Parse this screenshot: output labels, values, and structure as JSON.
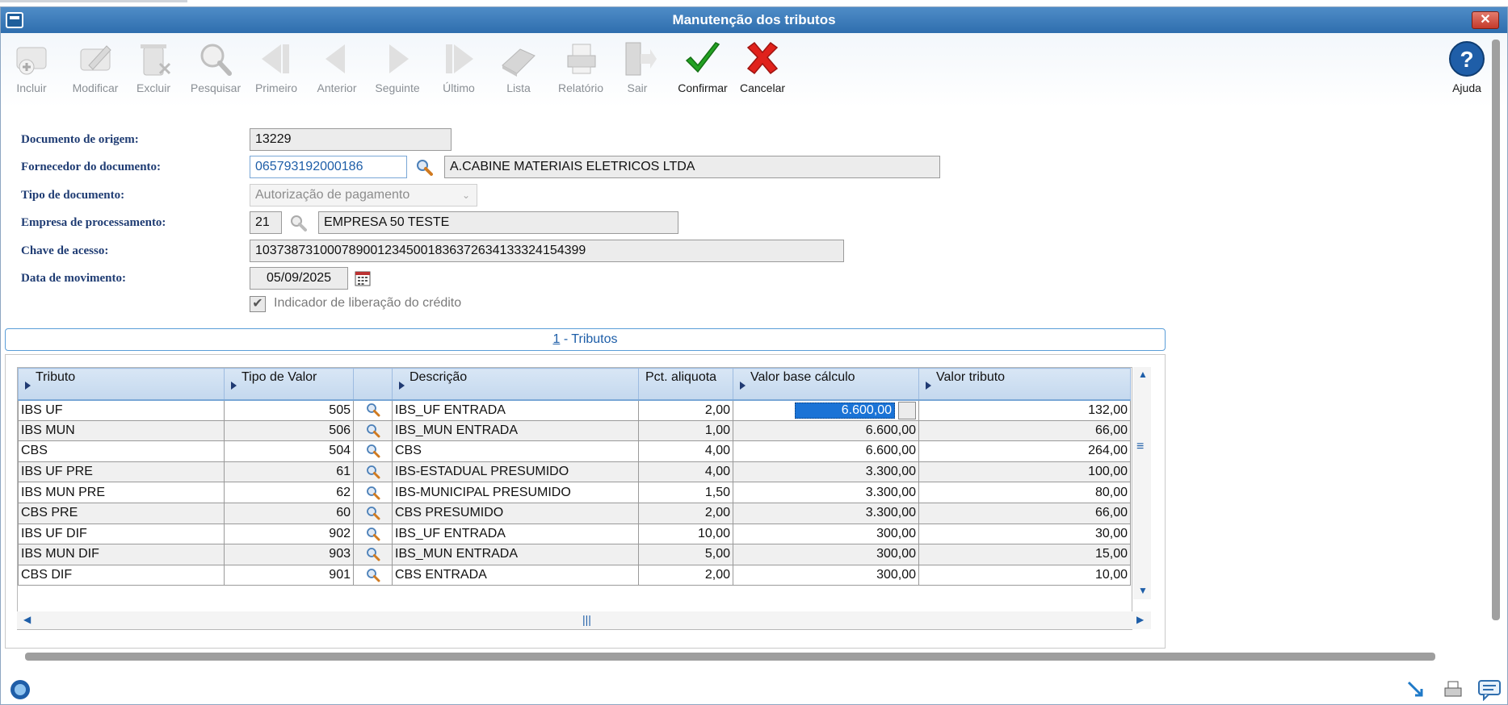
{
  "window": {
    "title": "Manutenção dos tributos"
  },
  "toolbar": {
    "buttons": [
      {
        "key": "incluir",
        "label": "Incluir",
        "enabled": false,
        "icon": "add-icon"
      },
      {
        "key": "modificar",
        "label": "Modificar",
        "enabled": false,
        "icon": "edit-icon"
      },
      {
        "key": "excluir",
        "label": "Excluir",
        "enabled": false,
        "icon": "trash-icon"
      },
      {
        "key": "pesquisar",
        "label": "Pesquisar",
        "enabled": false,
        "icon": "search-icon"
      },
      {
        "key": "primeiro",
        "label": "Primeiro",
        "enabled": false,
        "icon": "first-icon"
      },
      {
        "key": "anterior",
        "label": "Anterior",
        "enabled": false,
        "icon": "previous-icon"
      },
      {
        "key": "seguinte",
        "label": "Seguinte",
        "enabled": false,
        "icon": "next-icon"
      },
      {
        "key": "ultimo",
        "label": "Último",
        "enabled": false,
        "icon": "last-icon"
      },
      {
        "key": "lista",
        "label": "Lista",
        "enabled": false,
        "icon": "list-icon"
      },
      {
        "key": "relatorio",
        "label": "Relatório",
        "enabled": false,
        "icon": "printer-icon"
      },
      {
        "key": "sair",
        "label": "Sair",
        "enabled": false,
        "icon": "exit-icon"
      },
      {
        "key": "confirmar",
        "label": "Confirmar",
        "enabled": true,
        "icon": "check-icon"
      },
      {
        "key": "cancelar",
        "label": "Cancelar",
        "enabled": true,
        "icon": "cancel-icon"
      }
    ],
    "help_label": "Ajuda"
  },
  "form": {
    "documento_origem": {
      "label": "Documento de origem:",
      "value": "13229"
    },
    "fornecedor": {
      "label": "Fornecedor do documento:",
      "value": "065793192000186",
      "name": "A.CABINE MATERIAIS ELETRICOS LTDA"
    },
    "tipo_documento": {
      "label": "Tipo de documento:",
      "value": "Autorização de pagamento"
    },
    "empresa": {
      "label": "Empresa de processamento:",
      "value": "21",
      "name": "EMPRESA 50 TESTE"
    },
    "chave_acesso": {
      "label": "Chave de acesso:",
      "value": "10373873100078900123450018363726341333241543​99"
    },
    "data_movimento": {
      "label": "Data de movimento:",
      "value": "05/09/2025"
    },
    "indicador": {
      "label": "Indicador de liberação do crédito",
      "checked": true
    }
  },
  "section": {
    "number": "1",
    "title": " - Tributos"
  },
  "grid": {
    "columns": [
      "Tributo",
      "Tipo de Valor",
      "",
      "Descrição",
      "Pct. aliquota",
      "Valor base cálculo",
      "Valor tributo"
    ],
    "rows": [
      {
        "tributo": "IBS UF",
        "tipo": "505",
        "descricao": "IBS_UF ENTRADA",
        "pct": "2,00",
        "base": "6.600,00",
        "valor": "132,00",
        "editing": true
      },
      {
        "tributo": "IBS MUN",
        "tipo": "506",
        "descricao": "IBS_MUN ENTRADA",
        "pct": "1,00",
        "base": "6.600,00",
        "valor": "66,00"
      },
      {
        "tributo": "CBS",
        "tipo": "504",
        "descricao": "CBS",
        "pct": "4,00",
        "base": "6.600,00",
        "valor": "264,00"
      },
      {
        "tributo": "IBS UF PRE",
        "tipo": "61",
        "descricao": "IBS-ESTADUAL PRESUMIDO",
        "pct": "4,00",
        "base": "3.300,00",
        "valor": "100,00"
      },
      {
        "tributo": "IBS MUN PRE",
        "tipo": "62",
        "descricao": "IBS-MUNICIPAL PRESUMIDO",
        "pct": "1,50",
        "base": "3.300,00",
        "valor": "80,00"
      },
      {
        "tributo": "CBS PRE",
        "tipo": "60",
        "descricao": "CBS PRESUMIDO",
        "pct": "2,00",
        "base": "3.300,00",
        "valor": "66,00"
      },
      {
        "tributo": "IBS UF DIF",
        "tipo": "902",
        "descricao": "IBS_UF ENTRADA",
        "pct": "10,00",
        "base": "300,00",
        "valor": "30,00"
      },
      {
        "tributo": "IBS MUN DIF",
        "tipo": "903",
        "descricao": "IBS_MUN ENTRADA",
        "pct": "5,00",
        "base": "300,00",
        "valor": "15,00"
      },
      {
        "tributo": "CBS DIF",
        "tipo": "901",
        "descricao": "CBS ENTRADA",
        "pct": "2,00",
        "base": "300,00",
        "valor": "10,00"
      }
    ]
  },
  "colors": {
    "accent": "#1e5ea8",
    "title_bar": "#2f6eae",
    "header": "#c4d8ee",
    "confirm": "#1e9a1e",
    "cancel": "#e0221c"
  }
}
